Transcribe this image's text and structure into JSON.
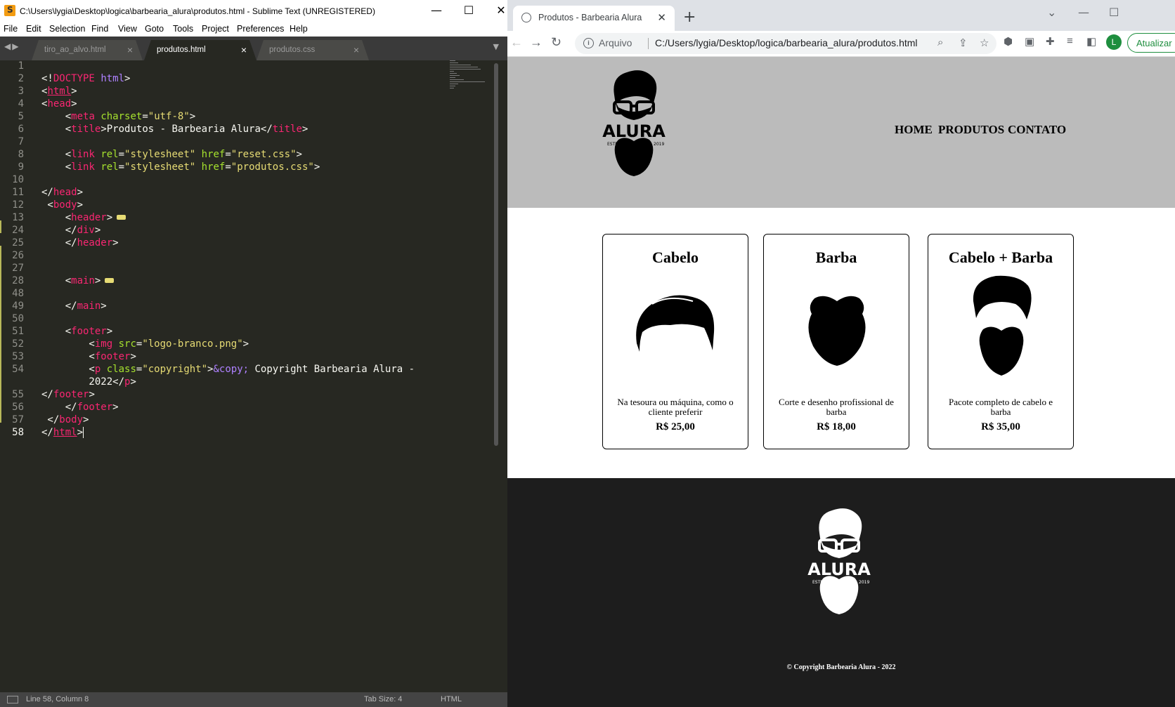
{
  "sublime": {
    "title": "C:\\Users\\lygia\\Desktop\\logica\\barbearia_alura\\produtos.html - Sublime Text (UNREGISTERED)",
    "menu": [
      "File",
      "Edit",
      "Selection",
      "Find",
      "View",
      "Goto",
      "Tools",
      "Project",
      "Preferences",
      "Help"
    ],
    "tabs": [
      {
        "label": "tiro_ao_alvo.html"
      },
      {
        "label": "produtos.html"
      },
      {
        "label": "produtos.css"
      }
    ],
    "line_numbers": [
      "1",
      "2",
      "3",
      "4",
      "5",
      "6",
      "7",
      "8",
      "9",
      "10",
      "11",
      "12",
      "13",
      "24",
      "25",
      "26",
      "27",
      "28",
      "48",
      "49",
      "50",
      "51",
      "52",
      "53",
      "54",
      "",
      "55",
      "56",
      "57",
      "58"
    ],
    "status": {
      "position": "Line 58, Column 8",
      "tab_size": "Tab Size: 4",
      "syntax": "HTML"
    }
  },
  "chrome": {
    "tab_title": "Produtos - Barbearia Alura",
    "scheme_label": "Arquivo",
    "url": "C:/Users/lygia/Desktop/logica/barbearia_alura/produtos.html",
    "avatar": "L",
    "update_label": "Atualizar"
  },
  "page": {
    "logo_text": "ALURA",
    "logo_estd": "ESTD",
    "logo_year": "2019",
    "nav": [
      "HOME",
      "PRODUTOS",
      "CONTATO"
    ],
    "cards": [
      {
        "title": "Cabelo",
        "description": "Na tesoura ou máquina, como o cliente preferir",
        "price": "R$ 25,00",
        "icon": "hair-icon"
      },
      {
        "title": "Barba",
        "description": "Corte e desenho profissional de barba",
        "price": "R$ 18,00",
        "icon": "beard-icon"
      },
      {
        "title": "Cabelo + Barba",
        "description": "Pacote completo de cabelo e barba",
        "price": "R$ 35,00",
        "icon": "hair-beard-icon"
      }
    ],
    "copyright": "© Copyright Barbearia Alura - 2022"
  },
  "colors": {
    "editor_bg": "#272822",
    "tag": "#f92672",
    "attr": "#a6e22e",
    "string": "#e6db74",
    "entity": "#ae81ff",
    "header_bg": "#bbbbbb",
    "footer_bg": "#1d1d1d"
  }
}
